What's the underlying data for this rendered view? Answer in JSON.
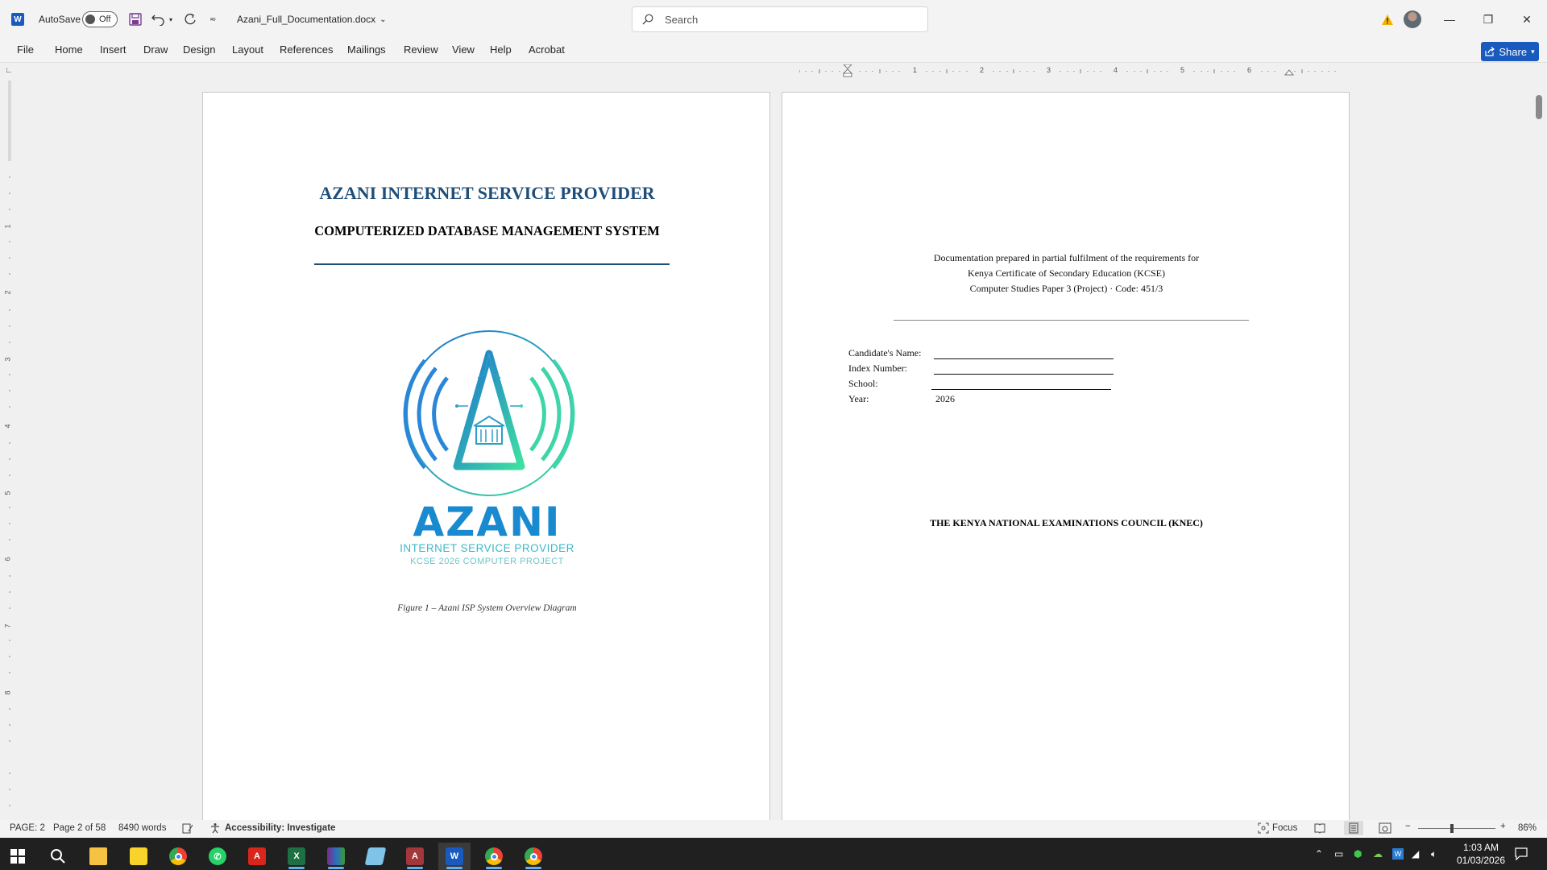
{
  "titlebar": {
    "autosave_label": "AutoSave",
    "autosave_state": "Off",
    "doc_title": "Azani_Full_Documentation.docx",
    "search_placeholder": "Search"
  },
  "ribbon": {
    "tabs": [
      "File",
      "Home",
      "Insert",
      "Draw",
      "Design",
      "Layout",
      "References",
      "Mailings",
      "Review",
      "View",
      "Help",
      "Acrobat"
    ],
    "share_label": "Share"
  },
  "ruler": {
    "h_numbers": [
      "1",
      "2",
      "3",
      "4",
      "5",
      "6"
    ],
    "v_numbers": [
      "1",
      "2",
      "3",
      "4",
      "5",
      "6",
      "7",
      "8"
    ]
  },
  "page_left": {
    "title": "AZANI INTERNET SERVICE PROVIDER",
    "subtitle": "COMPUTERIZED DATABASE MANAGEMENT SYSTEM",
    "logo_text": "AZANI",
    "logo_line2": "INTERNET SERVICE PROVIDER",
    "logo_line3": "KCSE 2026 COMPUTER PROJECT",
    "caption": "Figure 1 – Azani ISP System Overview Diagram"
  },
  "page_right": {
    "intro_line1": "Documentation prepared in partial fulfilment of the requirements for",
    "intro_line2": "Kenya Certificate of Secondary Education (KCSE)",
    "intro_line3": "Computer Studies Paper 3 (Project)  ·  Code: 451/3",
    "fields": [
      {
        "label": "Candidate's Name:",
        "value": ""
      },
      {
        "label": "Index Number:",
        "value": ""
      },
      {
        "label": "School:",
        "value": ""
      },
      {
        "label": "Year:",
        "value": "2026"
      }
    ],
    "council": "THE KENYA NATIONAL EXAMINATIONS COUNCIL (KNEC)"
  },
  "statusbar": {
    "page_field": "PAGE: 2",
    "page_of": "Page 2 of 58",
    "words": "8490 words",
    "accessibility": "Accessibility: Investigate",
    "focus": "Focus",
    "zoom": "86%"
  },
  "taskbar": {
    "time": "1:03 AM",
    "date": "01/03/2026"
  },
  "colors": {
    "title_blue": "#1f4e79",
    "word_blue": "#185abd",
    "logo_teal": "#2fc4b2"
  }
}
